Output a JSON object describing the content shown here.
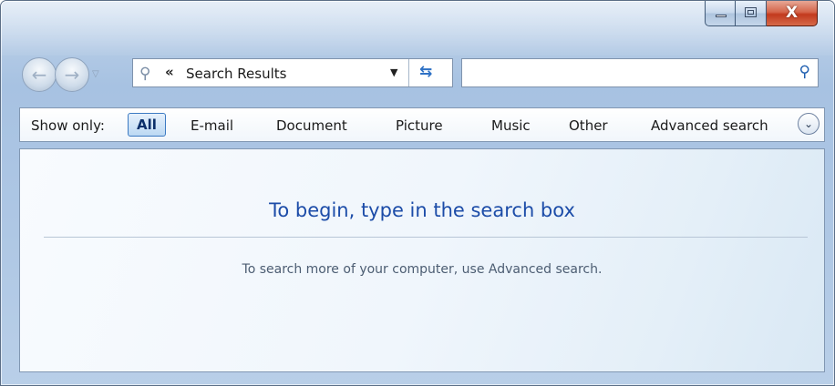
{
  "window": {
    "caption_buttons": {
      "minimize_icon": "minimize-icon",
      "maximize_icon": "maximize-icon",
      "close_icon": "close-icon",
      "close_glyph": "X"
    }
  },
  "navigation": {
    "back_icon": "back-arrow-icon",
    "forward_icon": "forward-arrow-icon",
    "recent_pages_icon": "dropdown-triangle-icon"
  },
  "address_bar": {
    "chevron": "«",
    "path": "Search Results",
    "refresh_icon": "refresh-icon"
  },
  "search_box": {
    "value": "",
    "placeholder": "",
    "icon": "search-icon"
  },
  "filter_bar": {
    "label": "Show only:",
    "items": [
      "All",
      "E-mail",
      "Document",
      "Picture",
      "Music",
      "Other"
    ],
    "selected": "All",
    "advanced_label": "Advanced search",
    "advanced_toggle_icon": "chevron-down-icon"
  },
  "content": {
    "title": "To begin, type in the search box",
    "subtitle": "To search more of your computer, use Advanced search."
  }
}
